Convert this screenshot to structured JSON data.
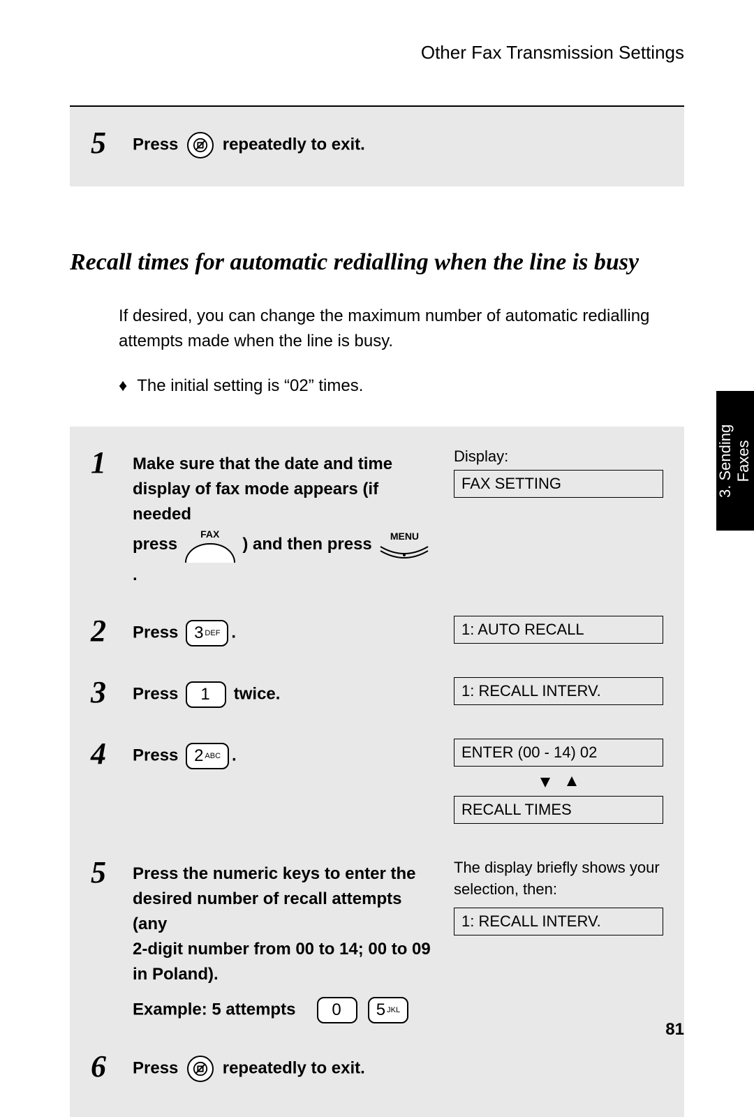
{
  "header": {
    "title": "Other Fax Transmission Settings"
  },
  "topbox": {
    "step5": {
      "num": "5",
      "press": "Press",
      "tail": "repeatedly to exit."
    }
  },
  "section": {
    "title": "Recall times for automatic redialling when the line is busy",
    "intro": "If desired, you can change the maximum number of automatic redialling attempts made when the line is busy.",
    "bullet": "The initial setting is “02” times."
  },
  "steps": {
    "s1": {
      "num": "1",
      "line_a": "Make sure that the date and time",
      "line_b": "display of fax mode appears (if needed",
      "press_word": "press",
      "fax_label": "FAX",
      "mid": ") and then press",
      "menu_label": "MENU",
      "tail_dot": ".",
      "disp_label": "Display:",
      "display": "FAX SETTING"
    },
    "s2": {
      "num": "2",
      "press": "Press",
      "key_main": "3",
      "key_sub": "DEF",
      "dot": ".",
      "display": "1: AUTO RECALL"
    },
    "s3": {
      "num": "3",
      "press": "Press",
      "key_main": "1",
      "tail": "twice.",
      "display": "1: RECALL INTERV."
    },
    "s4": {
      "num": "4",
      "press": "Press",
      "key_main": "2",
      "key_sub": "ABC",
      "dot": ".",
      "display_a": "ENTER (00 - 14) 02",
      "display_b": "RECALL TIMES"
    },
    "s5": {
      "num": "5",
      "line_a": "Press the numeric keys to enter the",
      "line_b": "desired number of recall attempts (any",
      "line_c": "2-digit number from 00 to 14; 00 to 09",
      "line_d": "in Poland).",
      "example_label": "Example: 5 attempts",
      "ex_key_a": "0",
      "ex_key_b_main": "5",
      "ex_key_b_sub": "JKL",
      "note": "The display briefly shows your selection, then:",
      "display": "1: RECALL INTERV."
    },
    "s6": {
      "num": "6",
      "press": "Press",
      "tail": "repeatedly to exit."
    }
  },
  "sidetab": {
    "line1": "3. Sending",
    "line2": "Faxes"
  },
  "page_number": "81"
}
